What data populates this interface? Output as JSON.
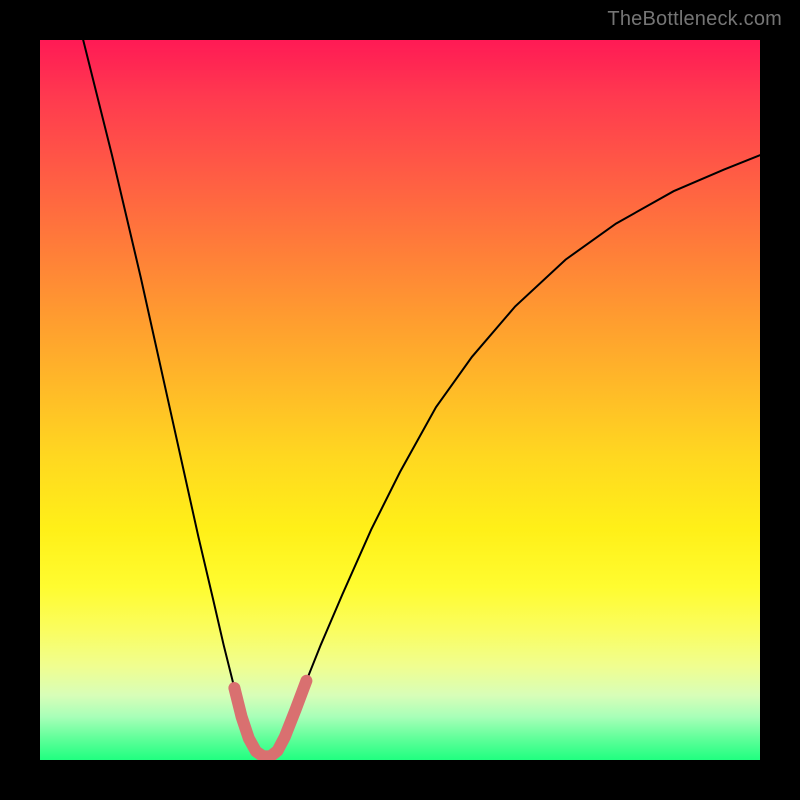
{
  "watermark": "TheBottleneck.com",
  "colors": {
    "background_frame": "#000000",
    "curve_stroke": "#000000",
    "highlight_stroke": "#d97070",
    "watermark_text": "#757575"
  },
  "chart_data": {
    "type": "line",
    "title": "",
    "xlabel": "",
    "ylabel": "",
    "xlim": [
      0,
      100
    ],
    "ylim": [
      0,
      100
    ],
    "curve_points": [
      {
        "x": 6.0,
        "y": 100.0
      },
      {
        "x": 8.0,
        "y": 92.0
      },
      {
        "x": 10.0,
        "y": 84.0
      },
      {
        "x": 12.0,
        "y": 75.5
      },
      {
        "x": 14.0,
        "y": 67.0
      },
      {
        "x": 16.0,
        "y": 58.0
      },
      {
        "x": 18.0,
        "y": 49.0
      },
      {
        "x": 20.0,
        "y": 40.0
      },
      {
        "x": 22.0,
        "y": 31.0
      },
      {
        "x": 24.0,
        "y": 22.5
      },
      {
        "x": 25.5,
        "y": 16.0
      },
      {
        "x": 27.0,
        "y": 10.0
      },
      {
        "x": 28.0,
        "y": 6.0
      },
      {
        "x": 29.0,
        "y": 3.0
      },
      {
        "x": 30.0,
        "y": 1.2
      },
      {
        "x": 31.0,
        "y": 0.5
      },
      {
        "x": 32.0,
        "y": 0.5
      },
      {
        "x": 33.0,
        "y": 1.3
      },
      {
        "x": 34.0,
        "y": 3.2
      },
      {
        "x": 35.5,
        "y": 7.0
      },
      {
        "x": 37.0,
        "y": 11.0
      },
      {
        "x": 39.0,
        "y": 16.0
      },
      {
        "x": 42.0,
        "y": 23.0
      },
      {
        "x": 46.0,
        "y": 32.0
      },
      {
        "x": 50.0,
        "y": 40.0
      },
      {
        "x": 55.0,
        "y": 49.0
      },
      {
        "x": 60.0,
        "y": 56.0
      },
      {
        "x": 66.0,
        "y": 63.0
      },
      {
        "x": 73.0,
        "y": 69.5
      },
      {
        "x": 80.0,
        "y": 74.5
      },
      {
        "x": 88.0,
        "y": 79.0
      },
      {
        "x": 95.0,
        "y": 82.0
      },
      {
        "x": 100.0,
        "y": 84.0
      }
    ],
    "highlight_points": [
      {
        "x": 27.0,
        "y": 10.0
      },
      {
        "x": 28.0,
        "y": 6.0
      },
      {
        "x": 29.0,
        "y": 3.0
      },
      {
        "x": 30.0,
        "y": 1.2
      },
      {
        "x": 31.0,
        "y": 0.5
      },
      {
        "x": 32.0,
        "y": 0.5
      },
      {
        "x": 33.0,
        "y": 1.3
      },
      {
        "x": 34.0,
        "y": 3.2
      },
      {
        "x": 35.5,
        "y": 7.0
      },
      {
        "x": 37.0,
        "y": 11.0
      }
    ]
  }
}
